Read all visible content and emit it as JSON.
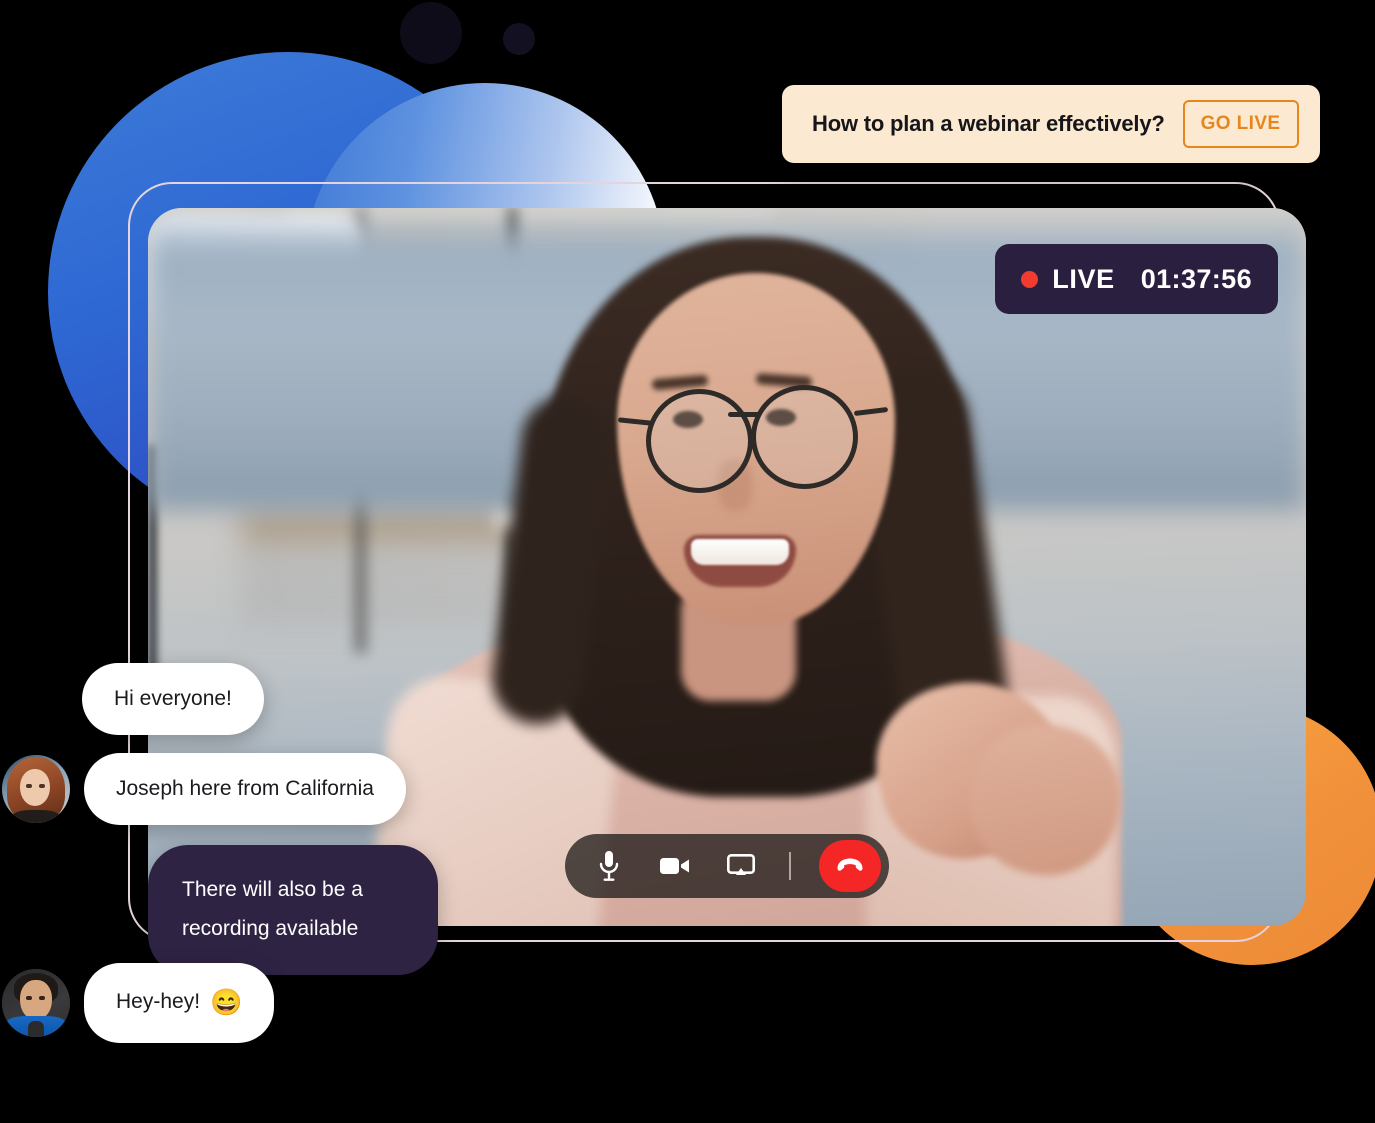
{
  "banner": {
    "question": "How to plan a webinar effectively?",
    "go_live_label": "GO LIVE",
    "background_color": "#FCE9D2",
    "accent_color": "#E5871C"
  },
  "video": {
    "live_badge": {
      "label": "LIVE",
      "timer": "01:37:56",
      "dot_color": "#F23B2F",
      "background_color": "#2B1F40"
    },
    "controls": [
      {
        "name": "microphone-button",
        "icon": "microphone-icon",
        "label": "Microphone"
      },
      {
        "name": "camera-button",
        "icon": "video-camera-icon",
        "label": "Camera"
      },
      {
        "name": "screen-share-button",
        "icon": "screen-share-icon",
        "label": "Share screen"
      },
      {
        "name": "end-call-button",
        "icon": "phone-hangup-icon",
        "label": "End call",
        "color": "#F42626"
      }
    ]
  },
  "chat": {
    "messages": [
      {
        "text": "Hi everyone!",
        "style": "light",
        "avatar": null
      },
      {
        "text": "Joseph here from California",
        "style": "light",
        "avatar": "woman-avatar"
      },
      {
        "text": "There will also be a recording available",
        "style": "dark",
        "avatar": null
      },
      {
        "text": "Hey-hey!",
        "emoji": "😄",
        "style": "light",
        "avatar": "man-avatar"
      }
    ],
    "bubble_light_color": "#FFFFFF",
    "bubble_dark_color": "#2E2343"
  },
  "decor": {
    "blue_solid": "#2E68D3",
    "blue_gradient_end": "#FFFFFF",
    "orange": "#F1913B",
    "dot_dark": "#0E0C18"
  }
}
